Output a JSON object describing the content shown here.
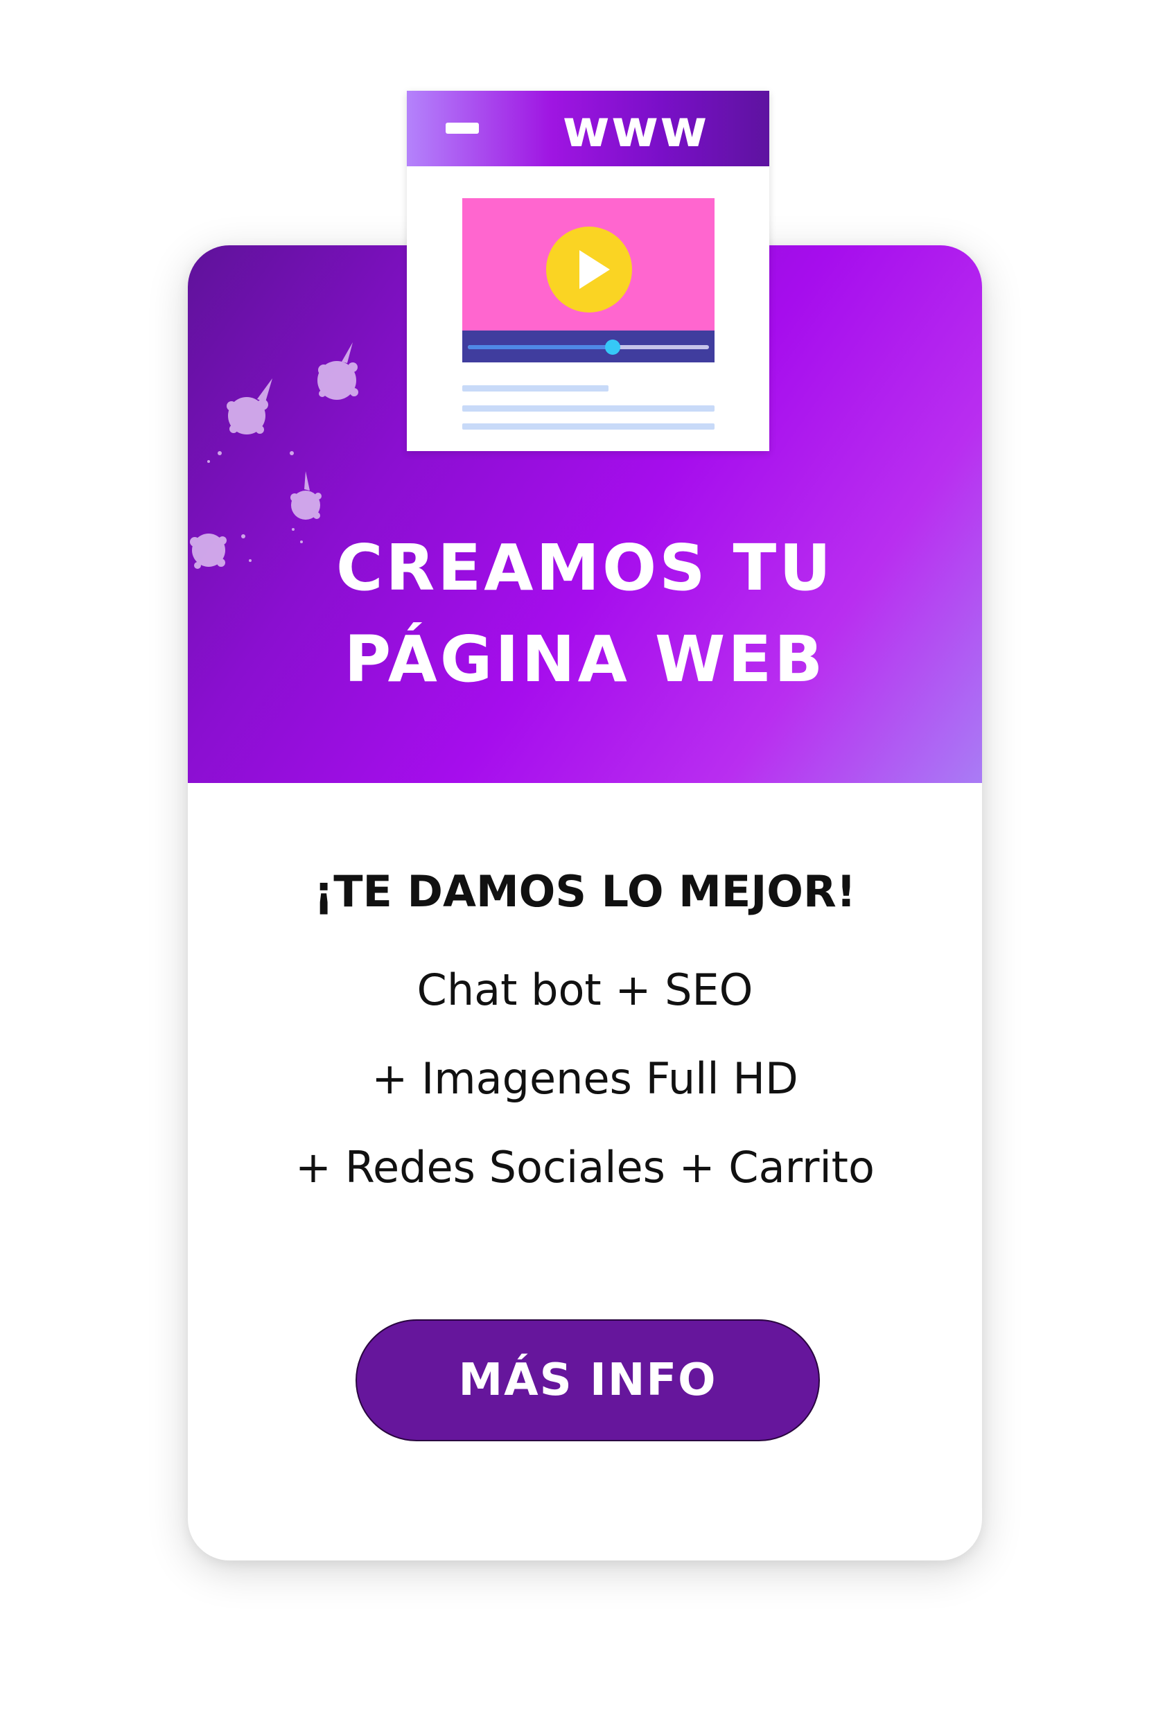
{
  "browser": {
    "url_text": "www",
    "icon": "window-minimize-icon",
    "video": {
      "icon": "play-icon",
      "progress": 0.6
    },
    "text_line_icon": "text-placeholder-lines"
  },
  "header": {
    "title_line_1": "CREAMOS TU",
    "title_line_2": "PÁGINA WEB",
    "decoration": "paint-splatter-icon"
  },
  "body": {
    "tagline": "¡TE DAMOS LO MEJOR!",
    "features": [
      "Chat bot + SEO",
      "+ Imagenes Full HD",
      "+ Redes Sociales + Carrito"
    ]
  },
  "cta": {
    "label": "MÁS INFO"
  },
  "colors": {
    "header_gradient_start": "#5f129a",
    "header_gradient_mid": "#a60ded",
    "header_gradient_end": "#a97cf5",
    "button_bg": "#66169c",
    "video_bg": "#ff66cf",
    "play_button": "#fad423",
    "controls_bg": "#403d9e",
    "seek_thumb": "#36c8f7",
    "text_dark": "#111111"
  }
}
